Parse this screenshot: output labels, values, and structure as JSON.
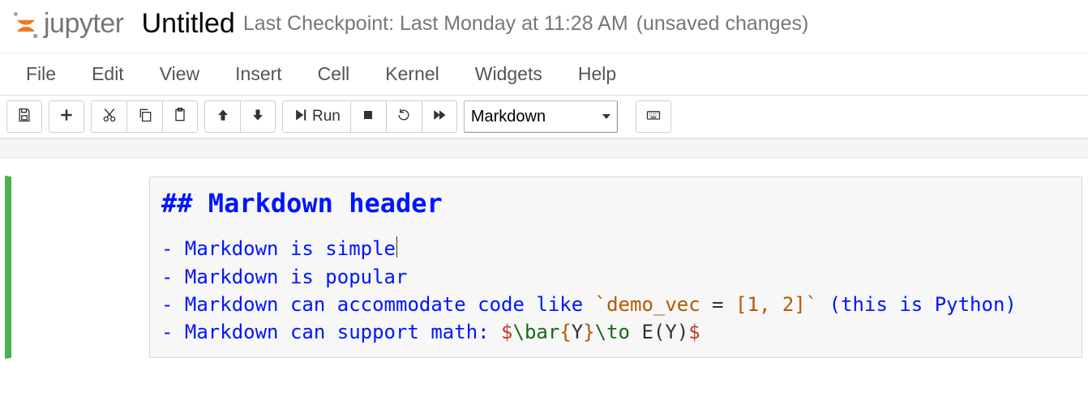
{
  "header": {
    "logo_text": "jupyter",
    "title": "Untitled",
    "checkpoint": "Last Checkpoint: Last Monday at 11:28 AM",
    "unsaved": "(unsaved changes)"
  },
  "menu": {
    "file": "File",
    "edit": "Edit",
    "view": "View",
    "insert": "Insert",
    "cell": "Cell",
    "kernel": "Kernel",
    "widgets": "Widgets",
    "help": "Help"
  },
  "toolbar": {
    "run_label": "Run",
    "cell_type": "Markdown",
    "icons": {
      "save": "save-icon",
      "add": "add-icon",
      "cut": "cut-icon",
      "copy": "copy-icon",
      "paste": "paste-icon",
      "up": "arrow-up-icon",
      "down": "arrow-down-icon",
      "run": "play-icon",
      "stop": "stop-icon",
      "restart": "restart-icon",
      "restart_run": "fast-forward-icon",
      "keyboard": "keyboard-icon"
    }
  },
  "cell": {
    "header": "## Markdown header",
    "line1_text": "Markdown is simple",
    "line2_text": "Markdown is popular",
    "line3_pre": "Markdown can accommodate code like ",
    "line3_code": "`demo_vec",
    "line3_eq": " = ",
    "line3_val": "[1, 2]`",
    "line3_post": " (this is Python)",
    "line4_pre": "Markdown can support math: ",
    "line4_dl1": "$",
    "line4_m1": "\\bar",
    "line4_br1": "{",
    "line4_m2": "Y",
    "line4_br2": "}",
    "line4_m3": "\\to",
    "line4_m4": " E(Y)",
    "line4_dl2": "$",
    "bullet": "- "
  }
}
